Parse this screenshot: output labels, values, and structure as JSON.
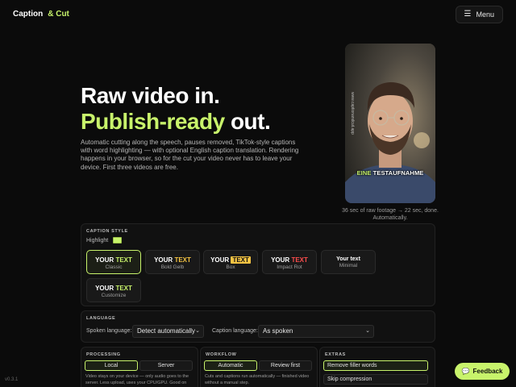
{
  "header": {
    "brand_main": "Caption",
    "brand_accent": "& Cut",
    "menu_icon": "☰",
    "menu_label": "Menu"
  },
  "hero": {
    "title_line1": "Raw video in.",
    "title_accent": "Publish-ready",
    "title_rest": " out.",
    "description": "Automatic cutting along the speech, pauses removed, TikTok-style captions with word highlighting — with optional English caption translation. Rendering happens in your browser, so for the cut your video never has to leave your device. First three videos are free."
  },
  "preview": {
    "caption_word1": "EINE",
    "caption_word2": "TESTAUFNAHME",
    "watermark": "www.captionandcut.app",
    "note": "36 sec of raw footage → 22 sec, done. Automatically."
  },
  "caption_style": {
    "title": "CAPTION STYLE",
    "highlight_label": "Highlight",
    "highlight_color": "#c8f36b",
    "styles": [
      {
        "word1": "YOUR",
        "word2": "TEXT",
        "name": "Classic",
        "selected": true
      },
      {
        "word1": "YOUR",
        "word2": "TEXT",
        "name": "Bold Gelb",
        "selected": false
      },
      {
        "word1": "YOUR",
        "word2": "TEXT",
        "name": "Box",
        "selected": false
      },
      {
        "word1": "YOUR",
        "word2": "TEXT",
        "name": "Impact Rot",
        "selected": false
      },
      {
        "word1": "Your text",
        "word2": "",
        "name": "Minimal",
        "selected": false
      },
      {
        "word1": "YOUR",
        "word2": "TEXT",
        "name": "Customize",
        "selected": false
      }
    ]
  },
  "language": {
    "title": "LANGUAGE",
    "spoken_label": "Spoken language:",
    "spoken_value": "Detect automatically",
    "caption_label": "Caption language:",
    "caption_value": "As spoken"
  },
  "processing": {
    "title": "PROCESSING",
    "local": "Local",
    "server": "Server",
    "desc": "Video stays on your device — only audio goes to the server. Less upload, uses your CPU/GPU. Good on"
  },
  "workflow": {
    "title": "WORKFLOW",
    "automatic": "Automatic",
    "review": "Review first",
    "desc": "Cuts and captions run automatically — finished video without a manual step."
  },
  "extras": {
    "title": "EXTRAS",
    "remove_filler": "Remove filler words",
    "skip_compression": "Skip compression"
  },
  "footer": {
    "version": "v0.3.1",
    "feedback_icon": "💬",
    "feedback_label": "Feedback"
  },
  "colors": {
    "accent": "#c8f36b",
    "background": "#0b0b0b"
  }
}
